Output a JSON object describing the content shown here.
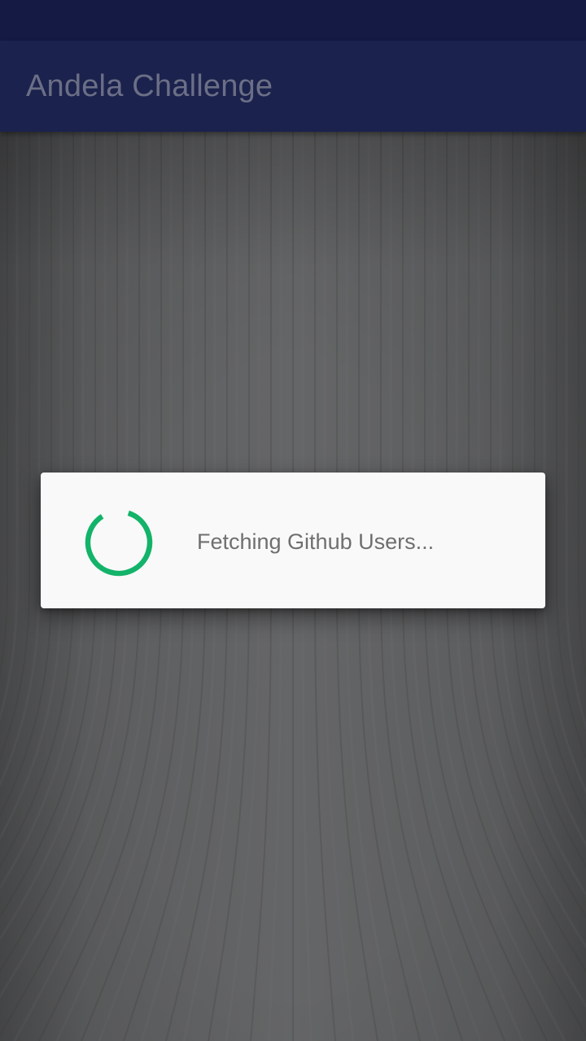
{
  "app_bar": {
    "title": "Andela Challenge"
  },
  "dialog": {
    "message": "Fetching Github Users...",
    "spinner_icon": "progress-spinner-icon"
  },
  "colors": {
    "status_bar": "#141a44",
    "app_bar": "#1b224d",
    "title_text": "#6b6f86",
    "spinner": "#13b369",
    "dialog_bg": "#f9f9f9",
    "message_text": "#6f6f6f",
    "background": "#636465"
  }
}
